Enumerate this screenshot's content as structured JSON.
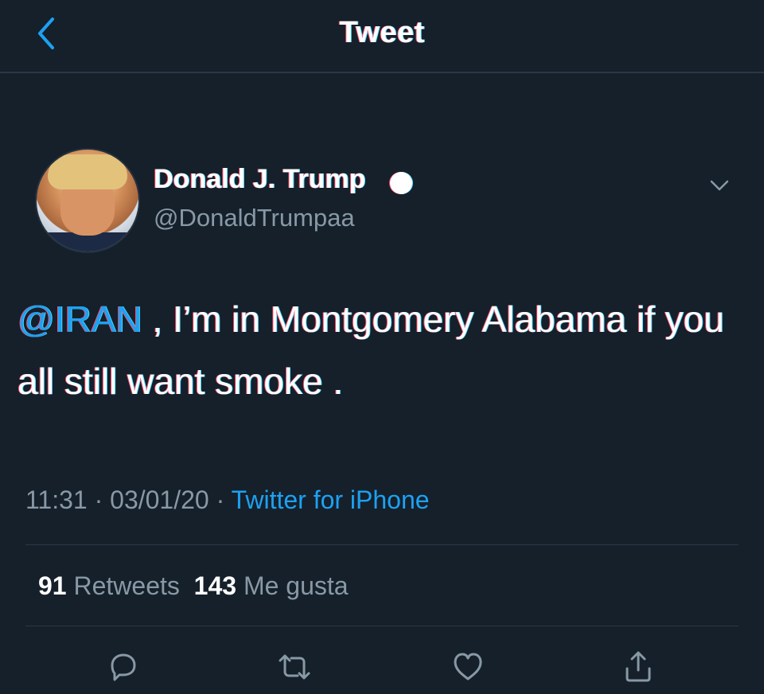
{
  "header": {
    "title": "Tweet",
    "back_icon": "chevron-left-icon"
  },
  "author": {
    "name": "Donald J. Trump",
    "handle": "@DonaldTrumpaa",
    "verified_icon": "verified-badge-icon"
  },
  "tweet": {
    "mention": "@IRAN",
    "text": " , I’m in Montgomery Alabama if you all still want smoke ."
  },
  "meta": {
    "time": "11:31",
    "separator": " · ",
    "date": "03/01/20",
    "source": "Twitter for iPhone"
  },
  "stats": {
    "retweets_count": "91",
    "retweets_label": "Retweets",
    "likes_count": "143",
    "likes_label": "Me gusta"
  },
  "actions": {
    "reply_icon": "reply-icon",
    "retweet_icon": "retweet-icon",
    "like_icon": "heart-icon",
    "share_icon": "share-icon"
  },
  "colors": {
    "background": "#15202b",
    "accent": "#1da1f2",
    "muted": "#8899a6",
    "divider": "#2a3744"
  }
}
